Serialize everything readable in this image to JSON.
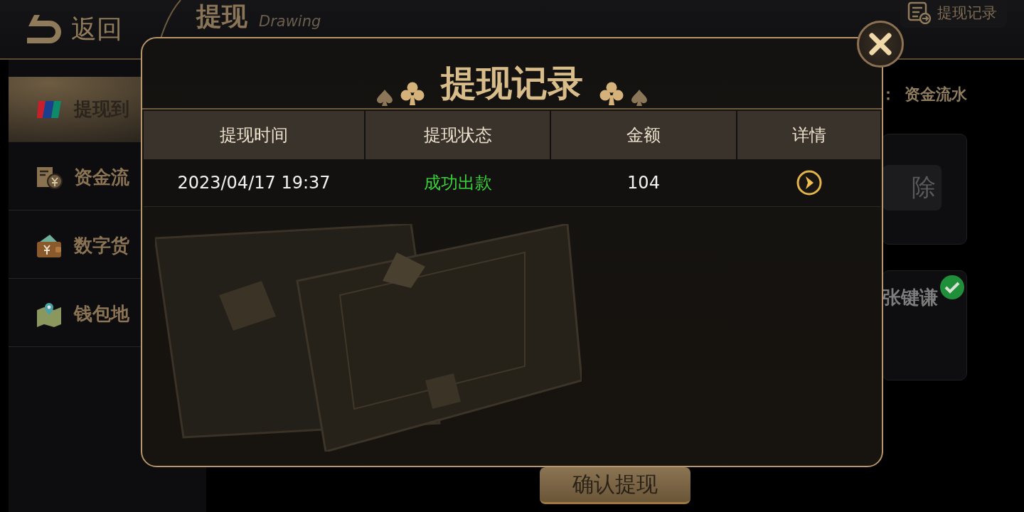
{
  "top_bar": {
    "back_label": "返回",
    "title": "提现",
    "subtitle": "Drawing",
    "records_button": "提现记录"
  },
  "sidebar": {
    "items": [
      {
        "label": "提现到",
        "kind": "card",
        "selected": true
      },
      {
        "label": "资金流",
        "kind": "ledger",
        "selected": false
      },
      {
        "label": "数字货",
        "kind": "wallet",
        "selected": false
      },
      {
        "label": "钱包地",
        "kind": "map",
        "selected": false
      }
    ]
  },
  "main": {
    "label_prefix": "：",
    "label_value": "资金流水",
    "card_button": "除",
    "account_name": "张键谦",
    "verified": true,
    "confirm_button": "确认提现"
  },
  "modal": {
    "title": "提现记录",
    "columns": [
      "提现时间",
      "提现状态",
      "金额",
      "详情"
    ],
    "rows": [
      {
        "time": "2023/04/17 19:37",
        "status": "成功出款",
        "amount": "104"
      }
    ]
  }
}
